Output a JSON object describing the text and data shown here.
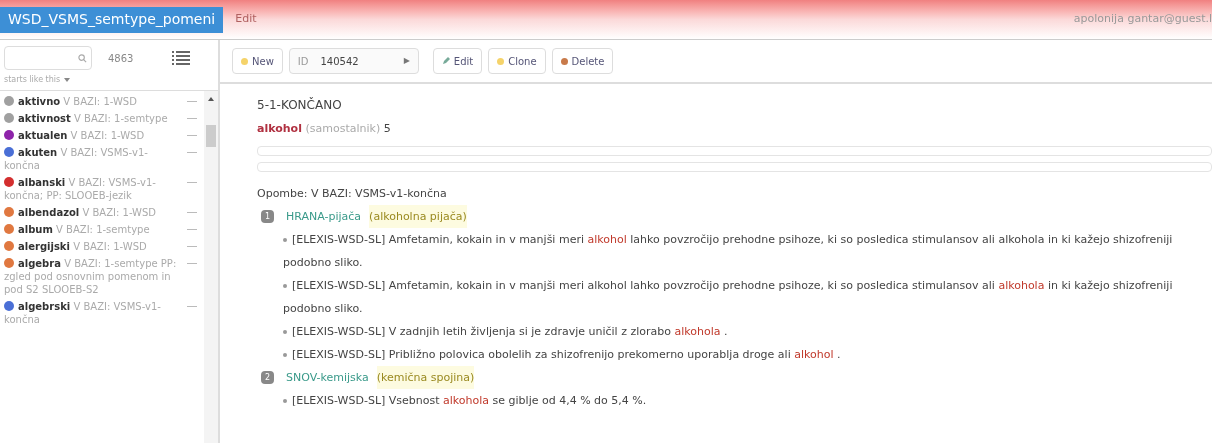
{
  "header": {
    "title": "WSD_VSMS_semtype_pomeni",
    "menu": "Edit",
    "user": "apolonija gantar@guest.l"
  },
  "sidebar": {
    "count": "4863",
    "filter": "starts like this",
    "items": [
      {
        "word": "aktivno",
        "info": "V BAZI: 1-WSD",
        "color": "#a0a0a0"
      },
      {
        "word": "aktivnost",
        "info": "V BAZI: 1-semtype",
        "color": "#a0a0a0"
      },
      {
        "word": "aktualen",
        "info": "V BAZI: 1-WSD",
        "color": "#8e24aa"
      },
      {
        "word": "akuten",
        "info": "V BAZI: VSMS-v1-končna",
        "color": "#4a6fd6"
      },
      {
        "word": "albanski",
        "info": "V BAZI: VSMS-v1-končna; PP: SLOOEB-jezik",
        "color": "#d32f2f"
      },
      {
        "word": "albendazol",
        "info": "V BAZI: 1-WSD",
        "color": "#e07840"
      },
      {
        "word": "album",
        "info": "V BAZI: 1-semtype",
        "color": "#e07840"
      },
      {
        "word": "alergijski",
        "info": "V BAZI: 1-WSD",
        "color": "#e07840"
      },
      {
        "word": "algebra",
        "info": "V BAZI: 1-semtype PP: zgled pod osnovnim pomenom in pod S2 SLOOEB-S2",
        "color": "#e07840"
      },
      {
        "word": "algebrski",
        "info": "V BAZI: VSMS-v1-končna",
        "color": "#4a6fd6"
      }
    ]
  },
  "toolbar": {
    "new": "New",
    "id_label": "ID",
    "id_value": "140542",
    "next": "▶",
    "edit": "Edit",
    "clone": "Clone",
    "delete": "Delete"
  },
  "entry": {
    "status": "5-1-KONČANO",
    "headword": "alkohol",
    "pos": "(samostalnik)",
    "number": "5",
    "note": "Opombe: V BAZI: VSMS-v1-končna",
    "senses": [
      {
        "number": "1",
        "category": "HRANA-pijača",
        "gloss": "(alkoholna pijača)",
        "examples": [
          "[ELEXIS-WSD-SL] Amfetamin, kokain in v manjši meri **alkohol** lahko povzročijo prehodne psihoze, ki so posledica stimulansov ali alkohola in ki kažejo shizofreniji podobno sliko.",
          "[ELEXIS-WSD-SL] Amfetamin, kokain in v manjši meri alkohol lahko povzročijo prehodne psihoze, ki so posledica stimulansov ali **alkohola** in ki kažejo shizofreniji podobno sliko.",
          "[ELEXIS-WSD-SL] V zadnjih letih življenja si je zdravje uničil z zlorabo **alkohola** .",
          "[ELEXIS-WSD-SL] Približno polovica obolelih za shizofrenijo prekomerno uporablja droge ali **alkohol** ."
        ]
      },
      {
        "number": "2",
        "category": "SNOV-kemijska",
        "gloss": "(kemična spojina)",
        "examples": [
          "[ELEXIS-WSD-SL] Vsebnost **alkohola** se giblje od 4,4 % do 5,4 %."
        ]
      }
    ]
  }
}
